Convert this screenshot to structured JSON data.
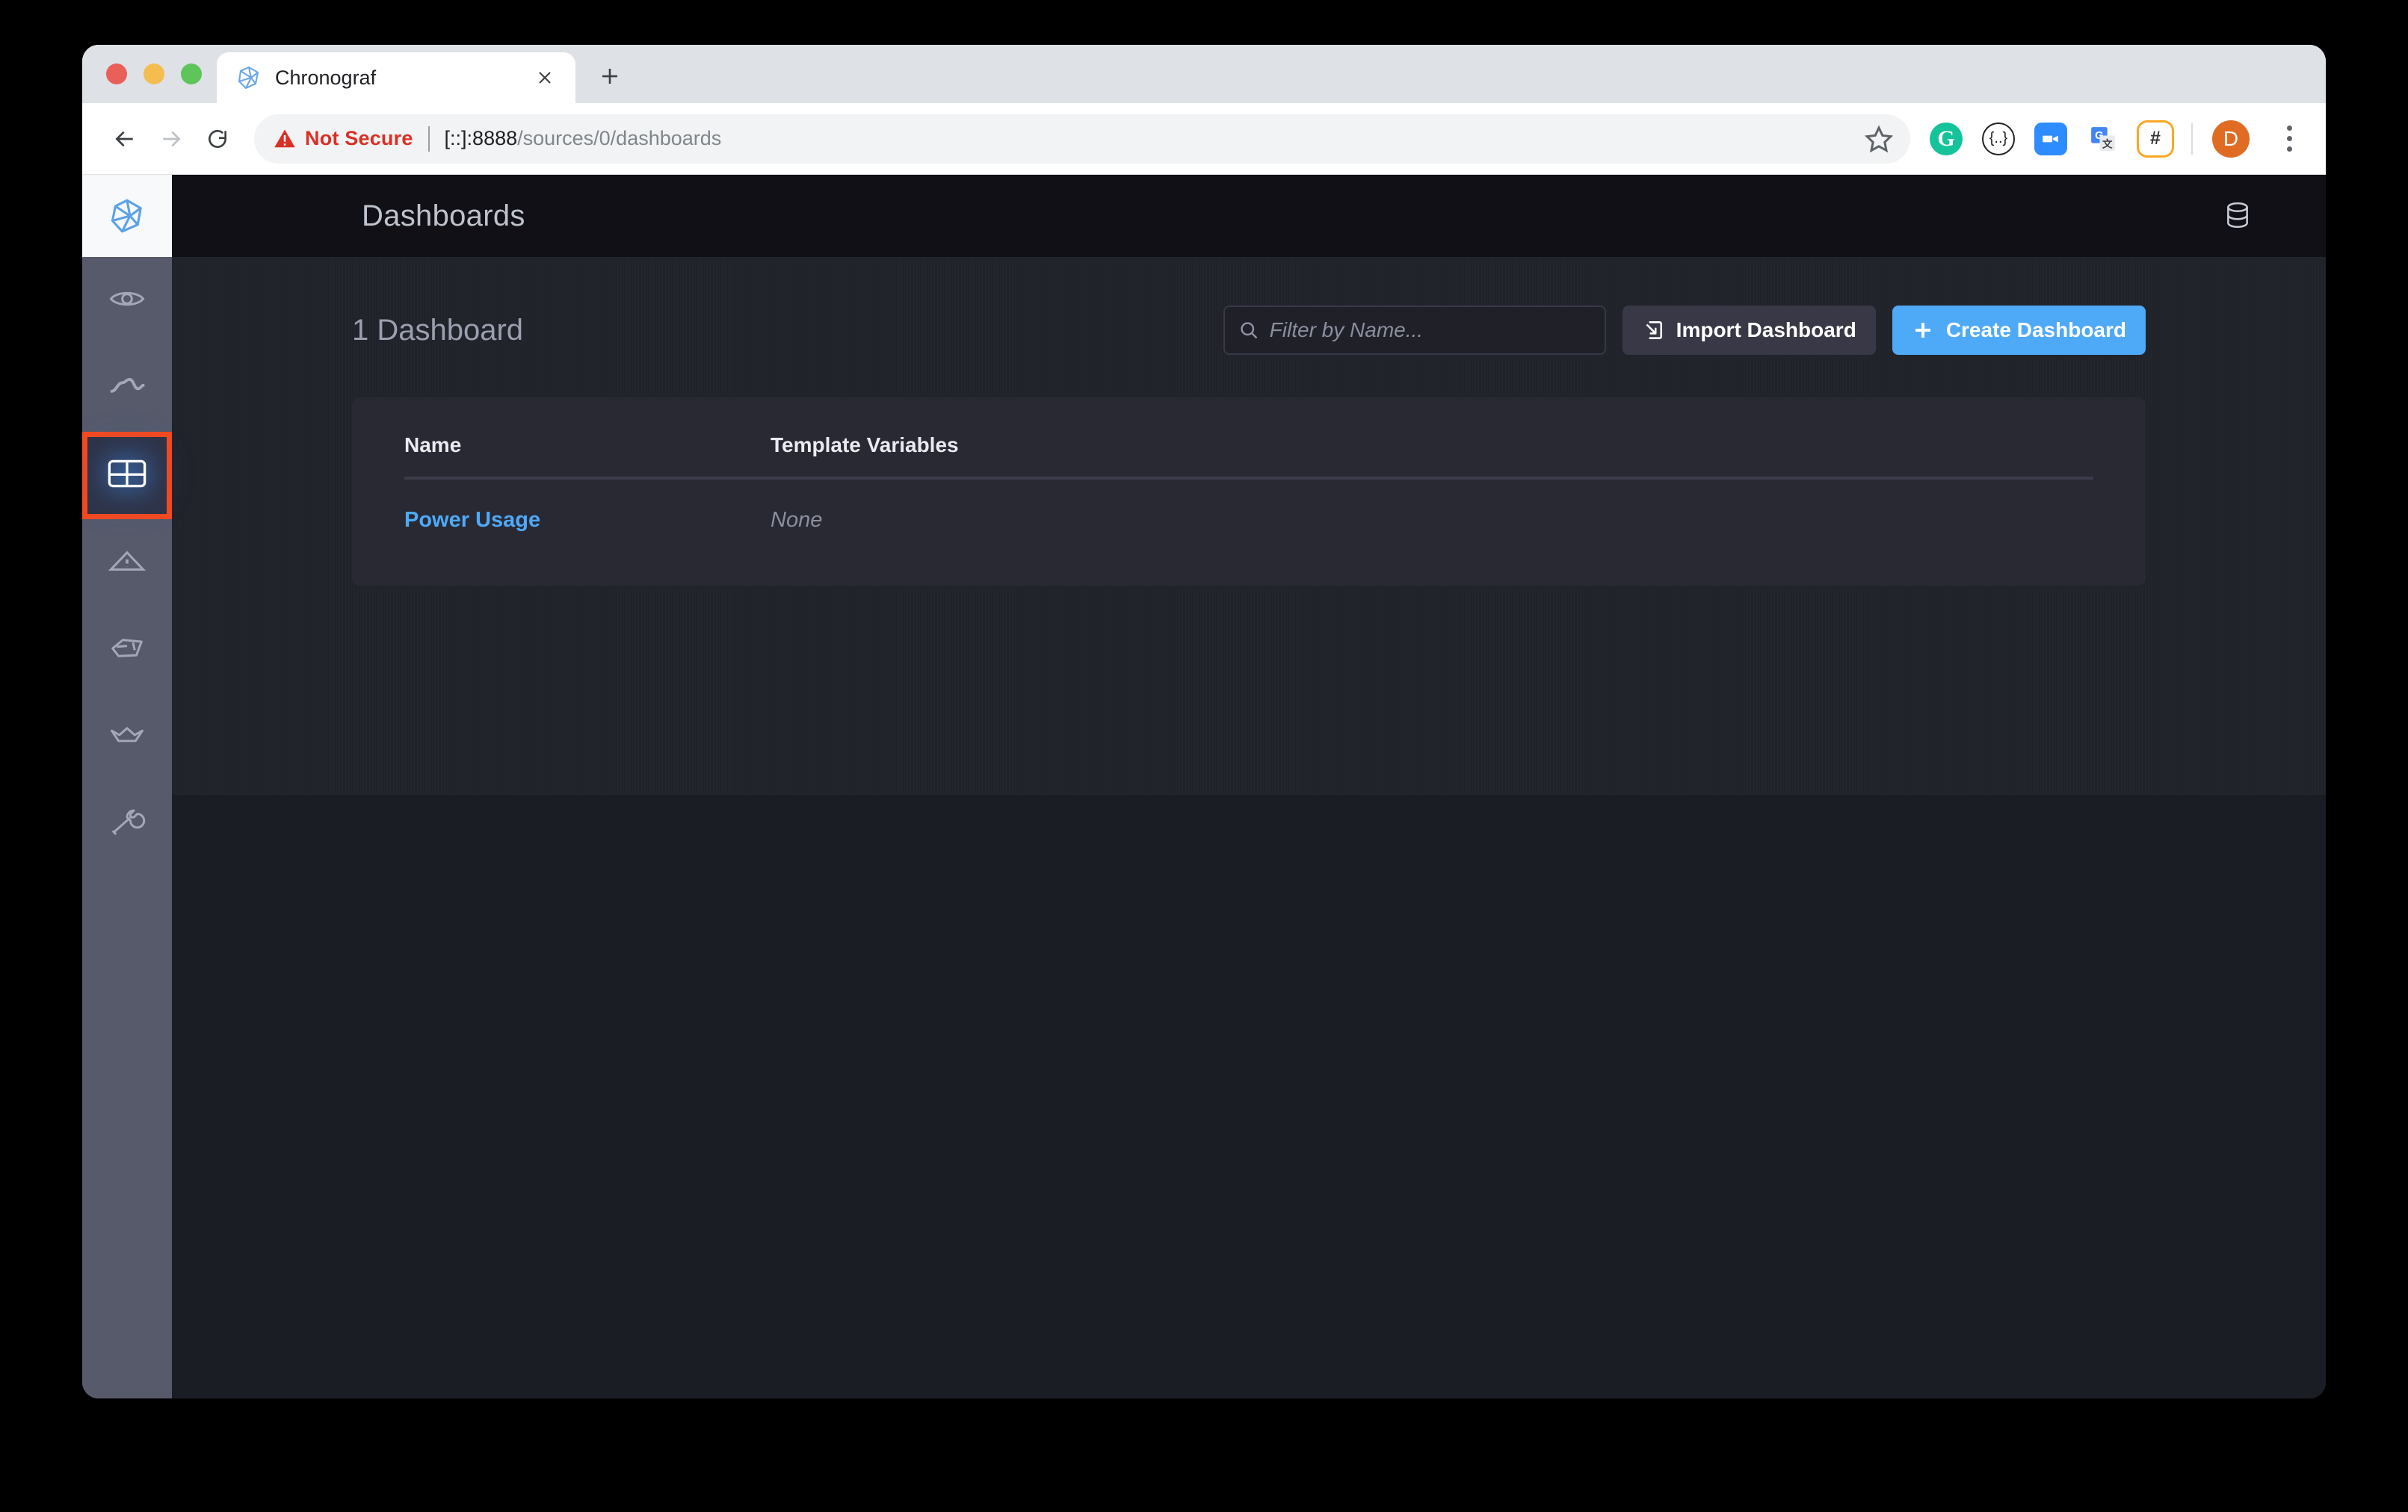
{
  "browser": {
    "tab": {
      "title": "Chronograf",
      "favicon_icon": "chronograf-cube-icon",
      "close_icon": "close-icon"
    },
    "new_tab_icon": "plus-icon",
    "nav": {
      "back_icon": "arrow-left-icon",
      "forward_icon": "arrow-right-icon",
      "reload_icon": "reload-icon"
    },
    "omnibox": {
      "warning_icon": "warning-triangle-icon",
      "security_label": "Not Secure",
      "url_host": "[::]:8888",
      "url_path": "/sources/0/dashboards",
      "bookmark_icon": "star-icon"
    },
    "extensions": [
      {
        "name": "grammarly-extension-icon",
        "label": "G"
      },
      {
        "name": "json-viewer-extension-icon",
        "label": "{..}"
      },
      {
        "name": "zoom-extension-icon",
        "label": ""
      },
      {
        "name": "google-translate-extension-icon",
        "label": ""
      },
      {
        "name": "hash-extension-icon",
        "label": "#"
      }
    ],
    "profile_initial": "D",
    "menu_icon": "kebab-menu-icon",
    "colors": {
      "tabstrip": "#dee1e6",
      "not_secure": "#d93025",
      "profile": "#e06c23"
    }
  },
  "app": {
    "side_nav": {
      "logo_icon": "chronograf-cube-logo-icon",
      "items": [
        {
          "name": "sidebar-item-host-list",
          "icon": "eye-icon",
          "active": false
        },
        {
          "name": "sidebar-item-data-explorer",
          "icon": "line-graph-icon",
          "active": false
        },
        {
          "name": "sidebar-item-dashboards",
          "icon": "dashboard-grid-icon",
          "active": true
        },
        {
          "name": "sidebar-item-alerting",
          "icon": "alert-triangle-icon",
          "active": false
        },
        {
          "name": "sidebar-item-infrastructure",
          "icon": "hand-cursor-icon",
          "active": false
        },
        {
          "name": "sidebar-item-admin",
          "icon": "crown-icon",
          "active": false
        },
        {
          "name": "sidebar-item-configuration",
          "icon": "wrench-icon",
          "active": false
        }
      ],
      "active_highlight_color": "#f4491f",
      "background_color": "#565a6b"
    },
    "header": {
      "title": "Dashboards",
      "source_icon": "database-stack-icon"
    },
    "controls": {
      "count_label": "1 Dashboard",
      "search": {
        "icon": "search-icon",
        "placeholder": "Filter by Name...",
        "value": ""
      },
      "import_button": {
        "label": "Import Dashboard",
        "icon": "import-arrow-icon"
      },
      "create_button": {
        "label": "Create Dashboard",
        "icon": "plus-icon",
        "color": "#4ea9f7"
      }
    },
    "table": {
      "columns": [
        "Name",
        "Template Variables"
      ],
      "rows": [
        {
          "name": "Power Usage",
          "template_variables": "None"
        }
      ]
    }
  }
}
